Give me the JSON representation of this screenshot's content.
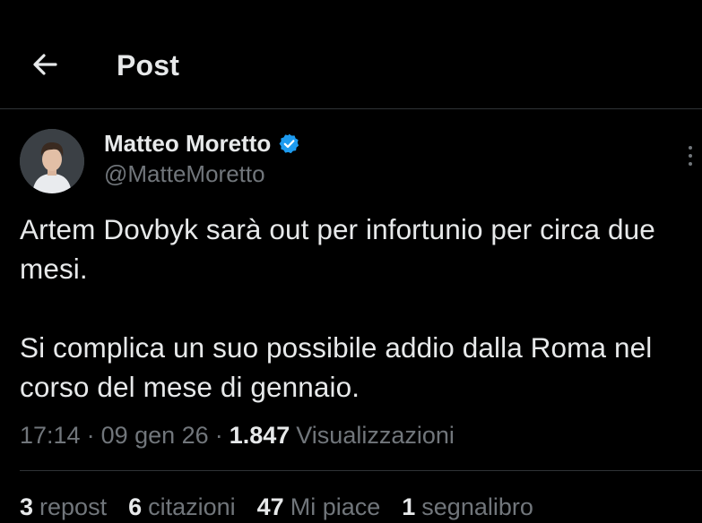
{
  "header": {
    "title": "Post",
    "back_icon": "arrow-left-icon"
  },
  "author": {
    "name": "Matteo Moretto",
    "handle": "@MatteMoretto",
    "verified": true,
    "verified_color": "#1d9bf0"
  },
  "tweet": {
    "paragraphs": [
      "Artem Dovbyk sarà out per infortunio per circa due mesi.",
      "Si complica un suo possibile addio dalla Roma nel corso del mese di gennaio."
    ]
  },
  "meta": {
    "time": "17:14",
    "date": "09 gen 26",
    "views_count": "1.847",
    "views_label": "Visualizzazioni"
  },
  "stats": {
    "reposts_count": "3",
    "reposts_label": "repost",
    "quotes_count": "6",
    "quotes_label": "citazioni",
    "likes_count": "47",
    "likes_label": "Mi piace",
    "bookmarks_count": "1",
    "bookmarks_label": "segnalibro"
  },
  "colors": {
    "background": "#000000",
    "text_primary": "#e7e9ea",
    "text_secondary": "#71767b",
    "divider": "#2f3336",
    "accent": "#1d9bf0"
  }
}
